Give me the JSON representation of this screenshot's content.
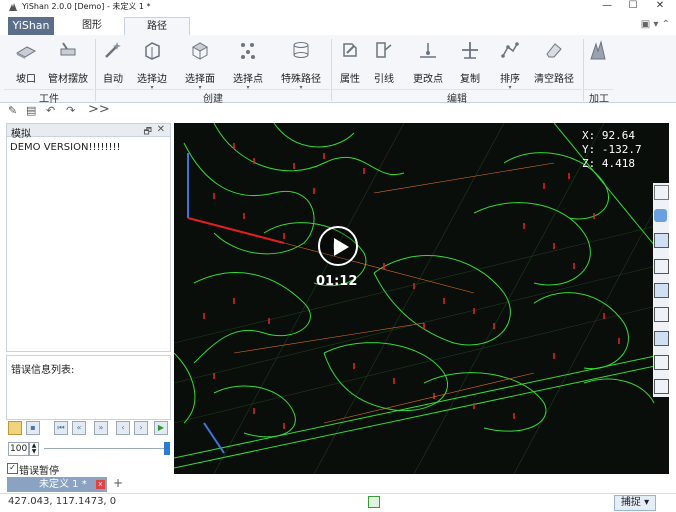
{
  "window": {
    "title": "YiShan 2.0.0  [Demo] - 未定义 1 *",
    "min_label": "—",
    "max_label": "☐",
    "close_label": "✕"
  },
  "ribbon": {
    "file_tab": "YiShan",
    "tabs": [
      "图形",
      "路径"
    ],
    "groups": {
      "work": {
        "label": "工件",
        "buttons": [
          "坡口",
          "管材摆放"
        ]
      },
      "create": {
        "label": "创建",
        "buttons": [
          "自动",
          "选择边",
          "选择面",
          "选择点",
          "特殊路径"
        ]
      },
      "edit": {
        "label": "编辑",
        "buttons": [
          "属性",
          "引线",
          "更改点",
          "复制",
          "排序",
          "清空路径"
        ]
      },
      "process": {
        "label": "加工",
        "buttons": []
      }
    }
  },
  "quick_toolbar": {
    "more": ">>"
  },
  "left_panel": {
    "sim_title": "模拟",
    "pin_label": "🗗",
    "close_label": "✕",
    "demo_text": "DEMO VERSION!!!!!!!!",
    "error_list_label": "错误信息列表:",
    "speed_value": "100",
    "error_pause_label": "错误暂停",
    "error_pause_checked": "✓",
    "doc_tab": "未定义 1 *",
    "doc_tab_close": "x",
    "add_tab": "+"
  },
  "viewport": {
    "coords": [
      "X: 92.64",
      "Y: -132.7",
      "Z: 4.418"
    ],
    "timecode": "01:12"
  },
  "status": {
    "coords": "427.043, 117.1473, 0",
    "snap_label": "捕捉 ▾"
  },
  "colors": {
    "file_tab": "#5b6f8a",
    "viewport_bg": "#0a0e0a",
    "path_green": "#35d835",
    "marker_red": "#e02020"
  }
}
